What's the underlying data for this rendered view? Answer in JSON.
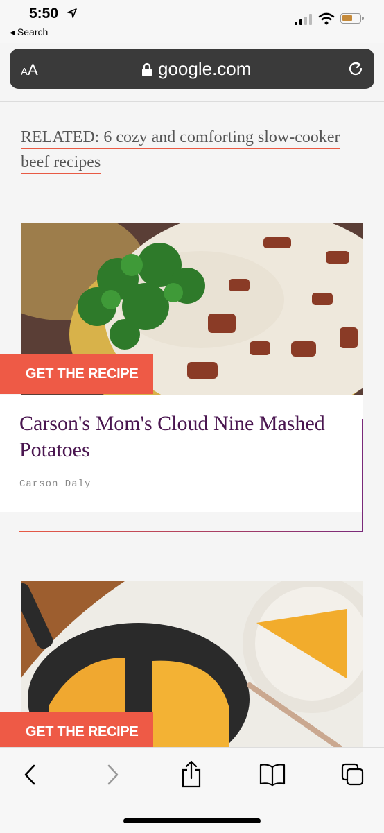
{
  "status": {
    "time": "5:50",
    "back_label": "◂ Search"
  },
  "urlbar": {
    "aa_small": "A",
    "aa_large": "A",
    "url": "google.com"
  },
  "related": {
    "text": "RELATED: 6 cozy and comforting slow-cooker beef recipes"
  },
  "cards": [
    {
      "cta": "GET THE RECIPE",
      "title": "Carson's Mom's Cloud Nine Mashed Potatoes",
      "author": "Carson Daly"
    },
    {
      "cta": "GET THE RECIPE"
    }
  ],
  "colors": {
    "accent": "#ee5a46",
    "title": "#4a1650",
    "urlbar": "#3a3a3a"
  },
  "toolbar": {
    "icons": [
      "back-icon",
      "forward-icon",
      "share-icon",
      "bookmarks-icon",
      "tabs-icon"
    ]
  }
}
